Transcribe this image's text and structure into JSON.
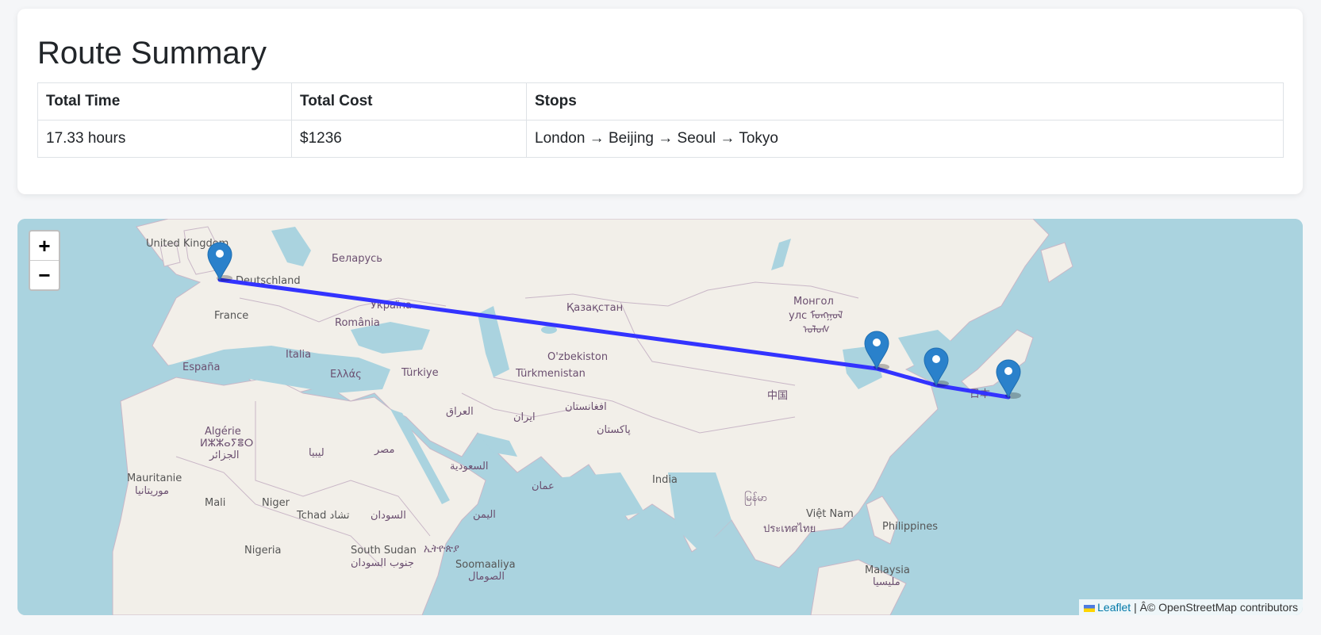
{
  "summary": {
    "title": "Route Summary",
    "headers": [
      "Total Time",
      "Total Cost",
      "Stops"
    ],
    "row": [
      "17.33 hours",
      "$1236",
      "London → Beijing → Seoul → Tokyo"
    ]
  },
  "map": {
    "zoom_in": "+",
    "zoom_out": "−",
    "attribution_link": "Leaflet",
    "attribution_rest": "| Â© OpenStreetMap contributors",
    "route_color": "#3333ff",
    "marker_color": "#2a81cb",
    "labels": {
      "uk": "United Kingdom",
      "belarus": "Беларусь",
      "deutschland": "Deutschland",
      "ukraina": "Україна",
      "france": "France",
      "romania": "România",
      "kazakhstan": "Қазақстан",
      "mongol": "Монгол",
      "mongol2": "улс ᠮᠣᠩᠭᠣᠯ",
      "mongol3": "ᠤᠯᠤᠰ",
      "espana": "España",
      "italia": "Italia",
      "ellas": "Ελλάς",
      "turkiye": "Türkiye",
      "uzbekistan": "O'zbekiston",
      "turkmenistan": "Türkmenistan",
      "china": "中国",
      "algerie": "Algérie",
      "algerie2": "ⵍⵣⵣⴰⵢⴻⵔ",
      "algerie3": "الجزائر",
      "iraq": "العراق",
      "iran": "ایران",
      "afghanistan": "افغانستان",
      "pakistan": "پاکستان",
      "japan": "日本",
      "libya": "ليبيا",
      "egypt": "مصر",
      "saudi": "السعودية",
      "mauritanie": "Mauritanie",
      "mauritanie2": "موريتانيا",
      "oman": "عمان",
      "india": "India",
      "mali": "Mali",
      "niger": "Niger",
      "tchad": "Tchad تشاد",
      "sudan": "السودان",
      "yemen": "اليمن",
      "myanmar": "မြန်မာ",
      "vietnam": "Việt Nam",
      "philippines": "Philippines",
      "thailand": "ประเทศไทย",
      "nigeria": "Nigeria",
      "southsudan": "South Sudan",
      "southsudan2": "جنوب السودان",
      "ethiopia": "ኢትዮጵያ",
      "somalia": "Soomaaliya",
      "somalia2": "الصومال",
      "malaysia": "Malaysia",
      "malaysia2": "مليسيا"
    }
  }
}
